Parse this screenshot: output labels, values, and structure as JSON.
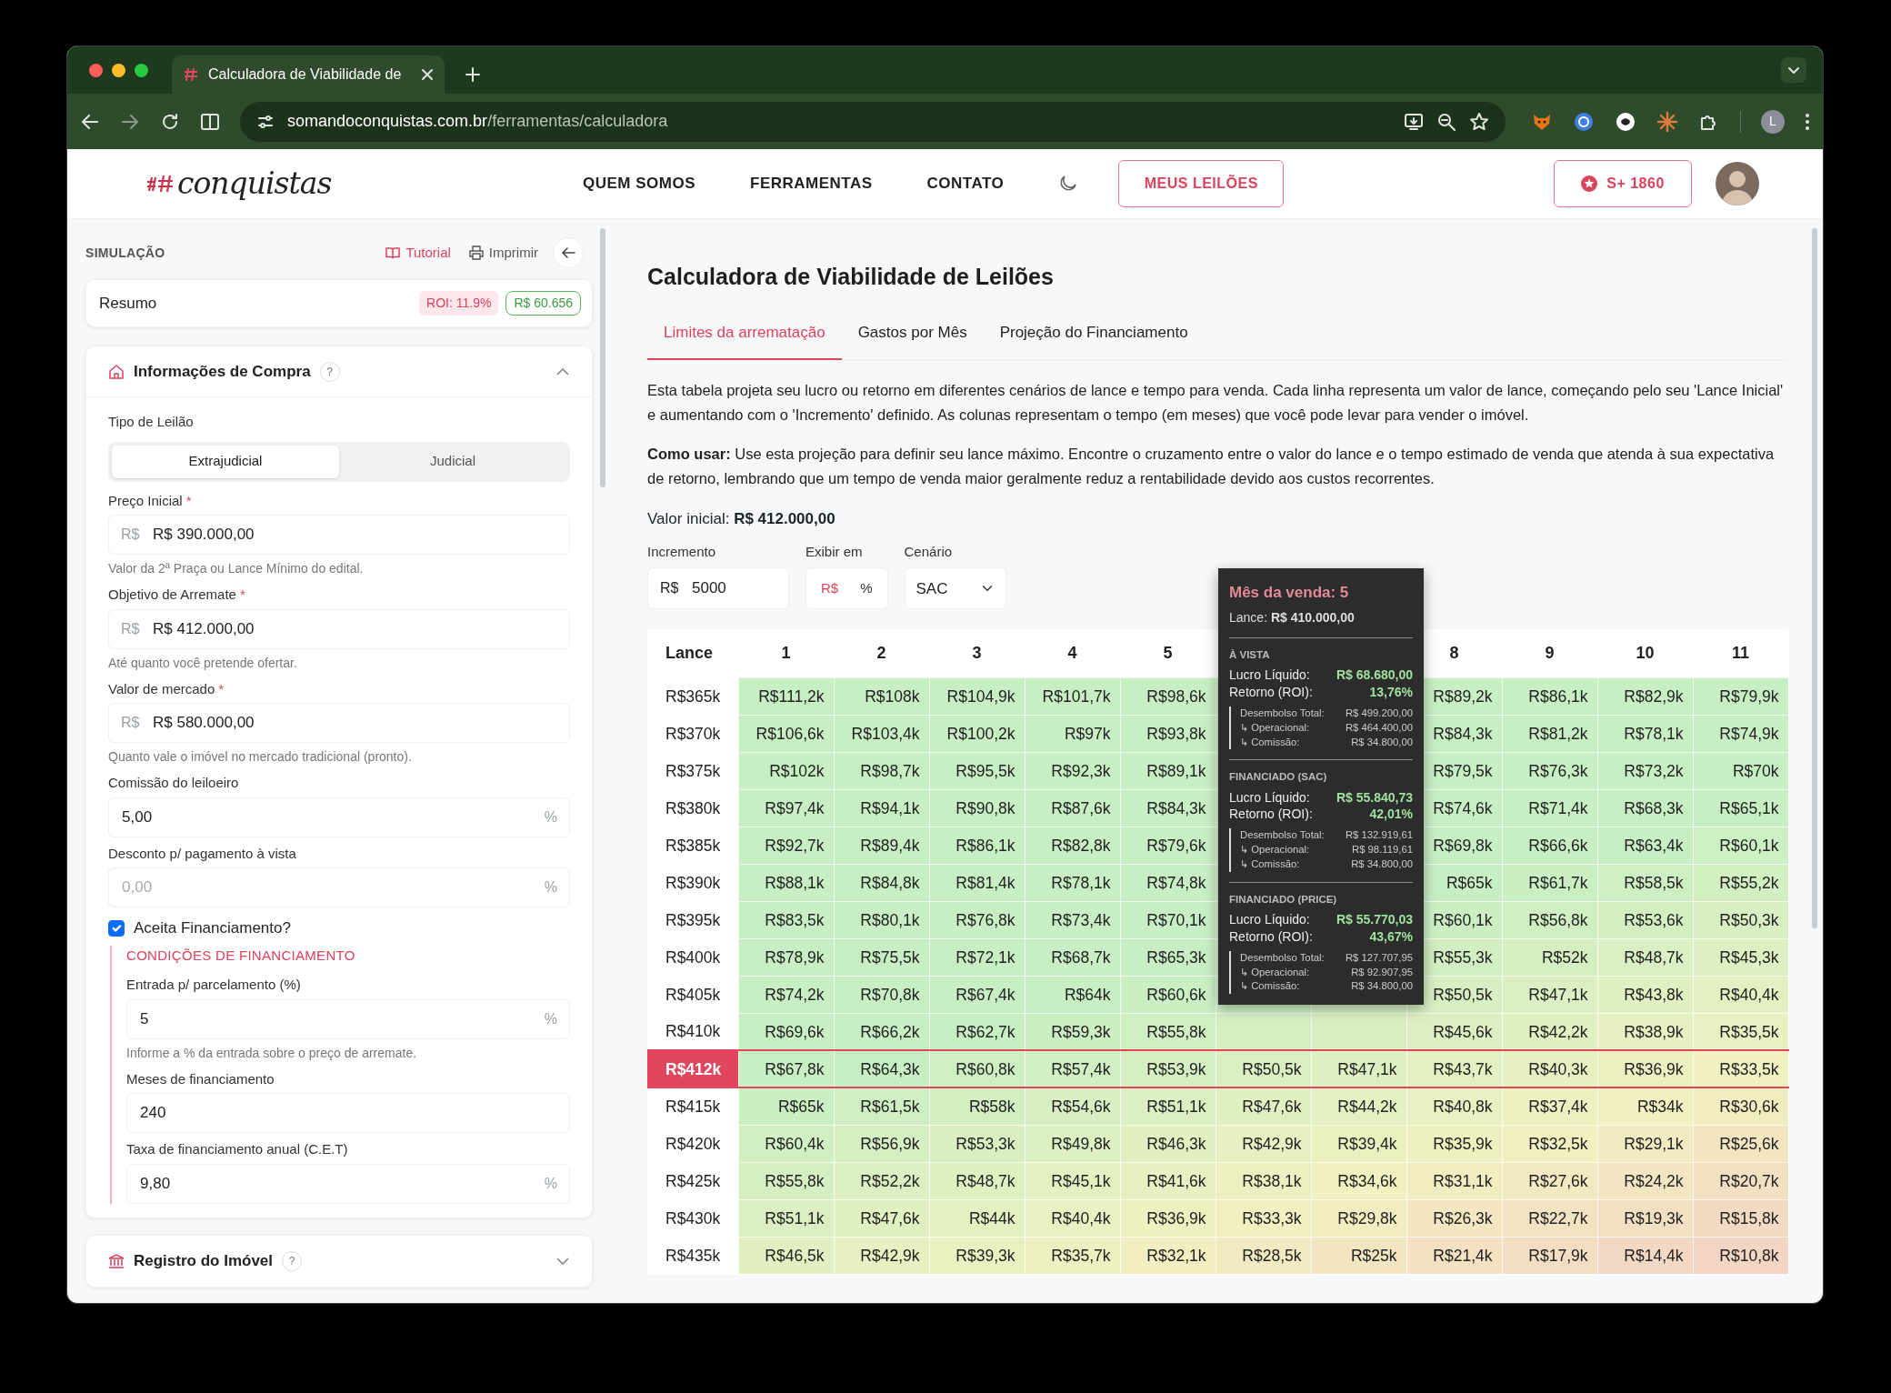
{
  "browser": {
    "tab_title": "Calculadora de Viabilidade de",
    "url_domain": "somandoconquistas.com.br",
    "url_path": "/ferramentas/calculadora",
    "profile": "L"
  },
  "navbar": {
    "logo": "conquistas",
    "links": [
      "QUEM SOMOS",
      "FERRAMENTAS",
      "CONTATO"
    ],
    "my_auctions": "MEUS LEILÕES",
    "points": "S+ 1860"
  },
  "sidebar": {
    "title": "SIMULAÇÃO",
    "tutorial": "Tutorial",
    "print": "Imprimir",
    "summary": {
      "label": "Resumo",
      "roi": "ROI: 11.9%",
      "profit": "R$ 60.656"
    },
    "sections": [
      {
        "kind": "purchase",
        "title": "Informações de Compra",
        "help": "?",
        "expanded": true,
        "items": [
          {
            "kind": "segmented",
            "label": "Tipo de Leilão",
            "options": [
              {
                "label": "Extrajudicial",
                "selected": true
              },
              {
                "label": "Judicial",
                "selected": false
              }
            ]
          },
          {
            "kind": "field",
            "label": "Preço Inicial",
            "required_mark": "*",
            "prefix": "R$",
            "value": "R$ 390.000,00",
            "hint": "Valor da 2ª Praça ou Lance Mínimo do edital."
          },
          {
            "kind": "field",
            "label": "Objetivo de Arremate",
            "required_mark": "*",
            "prefix": "R$",
            "value": "R$ 412.000,00",
            "hint": "Até quanto você pretende ofertar."
          },
          {
            "kind": "field",
            "label": "Valor de mercado",
            "required_mark": "*",
            "prefix": "R$",
            "value": "R$ 580.000,00",
            "hint": "Quanto vale o imóvel no mercado tradicional (pronto)."
          },
          {
            "kind": "field",
            "label": "Comissão do leiloeiro",
            "value": "5,00",
            "suffix": "%"
          },
          {
            "kind": "field",
            "label": "Desconto p/ pagamento à vista",
            "placeholder": "0,00",
            "suffix": "%"
          },
          {
            "kind": "checkbox",
            "label": "Aceita Financiamento?",
            "checked": true
          },
          {
            "kind": "group",
            "title": "CONDIÇÕES DE FINANCIAMENTO",
            "items": [
              {
                "kind": "field",
                "label": "Entrada p/ parcelamento (%)",
                "value": "5",
                "suffix": "%",
                "hint": "Informe a % da entrada sobre o preço de arremate."
              },
              {
                "kind": "field",
                "label": "Meses de financiamento",
                "value": "240"
              },
              {
                "kind": "field",
                "label": "Taxa de financiamento anual (C.E.T)",
                "value": "9,80",
                "suffix": "%"
              }
            ]
          }
        ]
      },
      {
        "kind": "registry",
        "title": "Registro do Imóvel",
        "help": "?",
        "expanded": false
      }
    ]
  },
  "main": {
    "title": "Calculadora de Viabilidade de Leilões",
    "tabs": [
      {
        "label": "Limites da arrematação",
        "selected": true
      },
      {
        "label": "Gastos por Mês",
        "selected": false
      },
      {
        "label": "Projeção do Financiamento",
        "selected": false
      }
    ],
    "paragraphs": [
      "Esta tabela projeta seu lucro ou retorno em diferentes cenários de lance e tempo para venda. Cada linha representa um valor de lance, começando pelo seu 'Lance Inicial' e aumentando com o 'Incremento' definido. As colunas representam o tempo (em meses) que você pode levar para vender o imóvel.",
      "**Como usar:** Use esta projeção para definir seu lance máximo. Encontre o cruzamento entre o valor do lance e o tempo estimado de venda que atenda à sua expectativa de retorno, lembrando que um tempo de venda maior geralmente reduz a rentabilidade devido aos custos recorrentes."
    ],
    "initial_value": "Valor inicial: **R$ 412.000,00**",
    "increment": {
      "label": "Incremento",
      "prefix": "R$",
      "value": "5000"
    },
    "display": {
      "label": "Exibir em",
      "options": [
        {
          "label": "R$",
          "selected": true
        },
        {
          "label": "%",
          "selected": false
        }
      ]
    },
    "scenario": {
      "label": "Cenário",
      "value": "SAC"
    },
    "table": {
      "columns": [
        "Lance",
        "1",
        "2",
        "3",
        "4",
        "5",
        null,
        null,
        "8",
        "9",
        "10",
        "11"
      ],
      "rows": [
        {
          "selected": false,
          "cells": [
            "R$365k",
            "R$111,2k",
            "R$108k",
            "R$104,9k",
            "R$101,7k",
            "R$98,6k",
            null,
            null,
            "R$89,2k",
            "R$86,1k",
            "R$82,9k",
            "R$79,9k"
          ]
        },
        {
          "selected": false,
          "cells": [
            "R$370k",
            "R$106,6k",
            "R$103,4k",
            "R$100,2k",
            "R$97k",
            "R$93,8k",
            null,
            null,
            "R$84,3k",
            "R$81,2k",
            "R$78,1k",
            "R$74,9k"
          ]
        },
        {
          "selected": false,
          "cells": [
            "R$375k",
            "R$102k",
            "R$98,7k",
            "R$95,5k",
            "R$92,3k",
            "R$89,1k",
            null,
            null,
            "R$79,5k",
            "R$76,3k",
            "R$73,2k",
            "R$70k"
          ]
        },
        {
          "selected": false,
          "cells": [
            "R$380k",
            "R$97,4k",
            "R$94,1k",
            "R$90,8k",
            "R$87,6k",
            "R$84,3k",
            null,
            null,
            "R$74,6k",
            "R$71,4k",
            "R$68,3k",
            "R$65,1k"
          ]
        },
        {
          "selected": false,
          "cells": [
            "R$385k",
            "R$92,7k",
            "R$89,4k",
            "R$86,1k",
            "R$82,8k",
            "R$79,6k",
            null,
            null,
            "R$69,8k",
            "R$66,6k",
            "R$63,4k",
            "R$60,1k"
          ]
        },
        {
          "selected": false,
          "cells": [
            "R$390k",
            "R$88,1k",
            "R$84,8k",
            "R$81,4k",
            "R$78,1k",
            "R$74,8k",
            null,
            null,
            "R$65k",
            "R$61,7k",
            "R$58,5k",
            "R$55,2k"
          ]
        },
        {
          "selected": false,
          "cells": [
            "R$395k",
            "R$83,5k",
            "R$80,1k",
            "R$76,8k",
            "R$73,4k",
            "R$70,1k",
            null,
            null,
            "R$60,1k",
            "R$56,8k",
            "R$53,6k",
            "R$50,3k"
          ]
        },
        {
          "selected": false,
          "cells": [
            "R$400k",
            "R$78,9k",
            "R$75,5k",
            "R$72,1k",
            "R$68,7k",
            "R$65,3k",
            null,
            null,
            "R$55,3k",
            "R$52k",
            "R$48,7k",
            "R$45,3k"
          ]
        },
        {
          "selected": false,
          "cells": [
            "R$405k",
            "R$74,2k",
            "R$70,8k",
            "R$67,4k",
            "R$64k",
            "R$60,6k",
            null,
            null,
            "R$50,5k",
            "R$47,1k",
            "R$43,8k",
            "R$40,4k"
          ]
        },
        {
          "selected": false,
          "cells": [
            "R$410k",
            "R$69,6k",
            "R$66,2k",
            "R$62,7k",
            "R$59,3k",
            "R$55,8k",
            null,
            null,
            "R$45,6k",
            "R$42,2k",
            "R$38,9k",
            "R$35,5k"
          ]
        },
        {
          "selected": true,
          "cells": [
            "R$412k",
            "R$67,8k",
            "R$64,3k",
            "R$60,8k",
            "R$57,4k",
            "R$53,9k",
            "R$50,5k",
            "R$47,1k",
            "R$43,7k",
            "R$40,3k",
            "R$36,9k",
            "R$33,5k"
          ]
        },
        {
          "selected": false,
          "cells": [
            "R$415k",
            "R$65k",
            "R$61,5k",
            "R$58k",
            "R$54,6k",
            "R$51,1k",
            "R$47,6k",
            "R$44,2k",
            "R$40,8k",
            "R$37,4k",
            "R$34k",
            "R$30,6k"
          ]
        },
        {
          "selected": false,
          "cells": [
            "R$420k",
            "R$60,4k",
            "R$56,9k",
            "R$53,3k",
            "R$49,8k",
            "R$46,3k",
            "R$42,9k",
            "R$39,4k",
            "R$35,9k",
            "R$32,5k",
            "R$29,1k",
            "R$25,6k"
          ]
        },
        {
          "selected": false,
          "cells": [
            "R$425k",
            "R$55,8k",
            "R$52,2k",
            "R$48,7k",
            "R$45,1k",
            "R$41,6k",
            "R$38,1k",
            "R$34,6k",
            "R$31,1k",
            "R$27,6k",
            "R$24,2k",
            "R$20,7k"
          ]
        },
        {
          "selected": false,
          "cells": [
            "R$430k",
            "R$51,1k",
            "R$47,6k",
            "R$44k",
            "R$40,4k",
            "R$36,9k",
            "R$33,3k",
            "R$29,8k",
            "R$26,3k",
            "R$22,7k",
            "R$19,3k",
            "R$15,8k"
          ]
        },
        {
          "selected": false,
          "cells": [
            "R$435k",
            "R$46,5k",
            "R$42,9k",
            "R$39,3k",
            "R$35,7k",
            "R$32,1k",
            "R$28,5k",
            "R$25k",
            "R$21,4k",
            "R$17,9k",
            "R$14,4k",
            "R$10,8k"
          ]
        }
      ]
    },
    "tooltip": {
      "title": "Mês da venda: 5",
      "lance": "Lance: **R$ 410.000,00**",
      "sections": [
        {
          "heading": "À VISTA",
          "lucro_label": "Lucro Líquido:",
          "lucro": "R$ 68.680,00",
          "roi_label": "Retorno (ROI):",
          "roi": "13,76%",
          "details": [
            {
              "label": "Desembolso Total:",
              "value": "R$ 499.200,00"
            },
            {
              "label": "↳ Operacional:",
              "value": "R$ 464.400,00"
            },
            {
              "label": "↳ Comissão:",
              "value": "R$ 34.800,00"
            }
          ]
        },
        {
          "heading": "FINANCIADO (SAC)",
          "lucro_label": "Lucro Líquido:",
          "lucro": "R$ 55.840,73",
          "roi_label": "Retorno (ROI):",
          "roi": "42,01%",
          "details": [
            {
              "label": "Desembolso Total:",
              "value": "R$ 132.919,61"
            },
            {
              "label": "↳ Operacional:",
              "value": "R$ 98.119,61"
            },
            {
              "label": "↳ Comissão:",
              "value": "R$ 34.800,00"
            }
          ]
        },
        {
          "heading": "FINANCIADO (PRICE)",
          "lucro_label": "Lucro Líquido:",
          "lucro": "R$ 55.770,03",
          "roi_label": "Retorno (ROI):",
          "roi": "43,67%",
          "details": [
            {
              "label": "Desembolso Total:",
              "value": "R$ 127.707,95"
            },
            {
              "label": "↳ Operacional:",
              "value": "R$ 92.907,95"
            },
            {
              "label": "↳ Comissão:",
              "value": "R$ 34.800,00"
            }
          ]
        }
      ]
    }
  }
}
